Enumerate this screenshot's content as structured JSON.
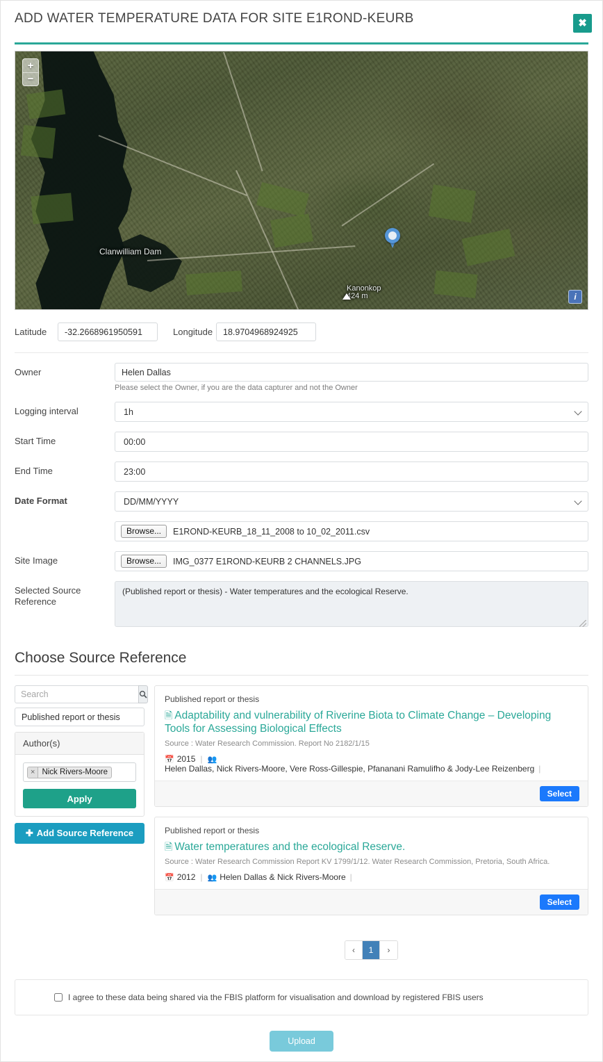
{
  "header": {
    "title": "ADD WATER TEMPERATURE DATA FOR SITE E1ROND-KEURB",
    "close_label": "✖"
  },
  "map": {
    "zoom_in_label": "+",
    "zoom_out_label": "−",
    "info_label": "i",
    "labels": [
      {
        "text": "Clanwilliam Dam"
      },
      {
        "text": "Kanonkop"
      },
      {
        "text": "424 m"
      }
    ]
  },
  "coords": {
    "latitude_label": "Latitude",
    "latitude_value": "-32.2668961950591",
    "longitude_label": "Longitude",
    "longitude_value": "18.9704968924925"
  },
  "form": {
    "owner_label": "Owner",
    "owner_value": "Helen Dallas",
    "owner_help": "Please select the Owner, if you are the data capturer and not the Owner",
    "logging_interval_label": "Logging interval",
    "logging_interval_value": "1h",
    "start_time_label": "Start Time",
    "start_time_value": "00:00",
    "end_time_label": "End Time",
    "end_time_value": "23:00",
    "date_format_label": "Date Format",
    "date_format_value": "DD/MM/YYYY",
    "browse_label": "Browse...",
    "data_file_name": "E1ROND-KEURB_18_11_2008 to 10_02_2011.csv",
    "site_image_label": "Site Image",
    "site_image_file_name": "IMG_0377 E1ROND-KEURB 2 CHANNELS.JPG",
    "selected_source_label_line1": "Selected Source",
    "selected_source_label_line2": "Reference",
    "selected_source_value": "(Published report or thesis) - Water temperatures and the ecological Reserve."
  },
  "choose_source": {
    "heading": "Choose Source Reference",
    "search_placeholder": "Search",
    "search_value": "",
    "search_icon": "⌕",
    "type_filter_value": "Published report or thesis",
    "authors_panel_title": "Author(s)",
    "author_tag": "Nick Rivers-Moore",
    "author_tag_remove": "×",
    "apply_label": "Apply",
    "add_reference_label": "Add Source Reference",
    "add_reference_plus": "✚"
  },
  "references": [
    {
      "type": "Published report or thesis",
      "title": "Adaptability and vulnerability of Riverine Biota to Climate Change – Developing Tools for Assessing Biological Effects",
      "source": "Source : Water Research Commission. Report No 2182/1/15",
      "year": "2015",
      "authors": "Helen Dallas, Nick Rivers-Moore, Vere Ross-Gillespie, Pfananani Ramulifho & Jody-Lee Reizenberg",
      "select_label": "Select"
    },
    {
      "type": "Published report or thesis",
      "title": "Water temperatures and the ecological Reserve.",
      "source": "Source : Water Research Commission Report KV 1799/1/12. Water Research Commission, Pretoria, South Africa.",
      "year": "2012",
      "authors": "Helen Dallas & Nick Rivers-Moore",
      "select_label": "Select"
    }
  ],
  "pagination": {
    "prev": "‹",
    "current": "1",
    "next": "›"
  },
  "agreement": {
    "text": "I agree to these data being shared via the FBIS platform for visualisation and download by registered FBIS users",
    "checked": false
  },
  "upload": {
    "label": "Upload"
  },
  "colors": {
    "accent_teal": "#2aa898",
    "close_teal": "#189b8c",
    "apply_green": "#1ea189",
    "add_blue": "#1b9dc0",
    "select_blue": "#1b79fc",
    "pager_blue": "#4281b8",
    "upload_blue": "#6ec6d9"
  }
}
